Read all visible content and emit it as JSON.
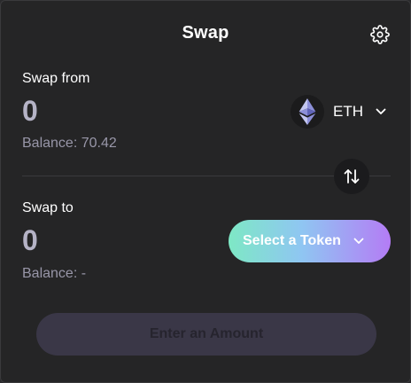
{
  "header": {
    "title": "Swap",
    "settings_icon": "gear-icon"
  },
  "from": {
    "label": "Swap from",
    "amount": "0",
    "balance": "Balance: 70.42",
    "token": {
      "symbol": "ETH",
      "icon": "ethereum-icon"
    }
  },
  "switch_icon": "swap-vertical-arrows-icon",
  "to": {
    "label": "Swap to",
    "amount": "0",
    "balance": "Balance: -",
    "select_label": "Select a Token"
  },
  "action": {
    "label": "Enter an Amount"
  },
  "colors": {
    "background": "#252526",
    "amount_text": "#b5b3c6",
    "gradient_start": "#7ee8c5",
    "gradient_end": "#b47cf5",
    "disabled_button": "#3a3747"
  }
}
